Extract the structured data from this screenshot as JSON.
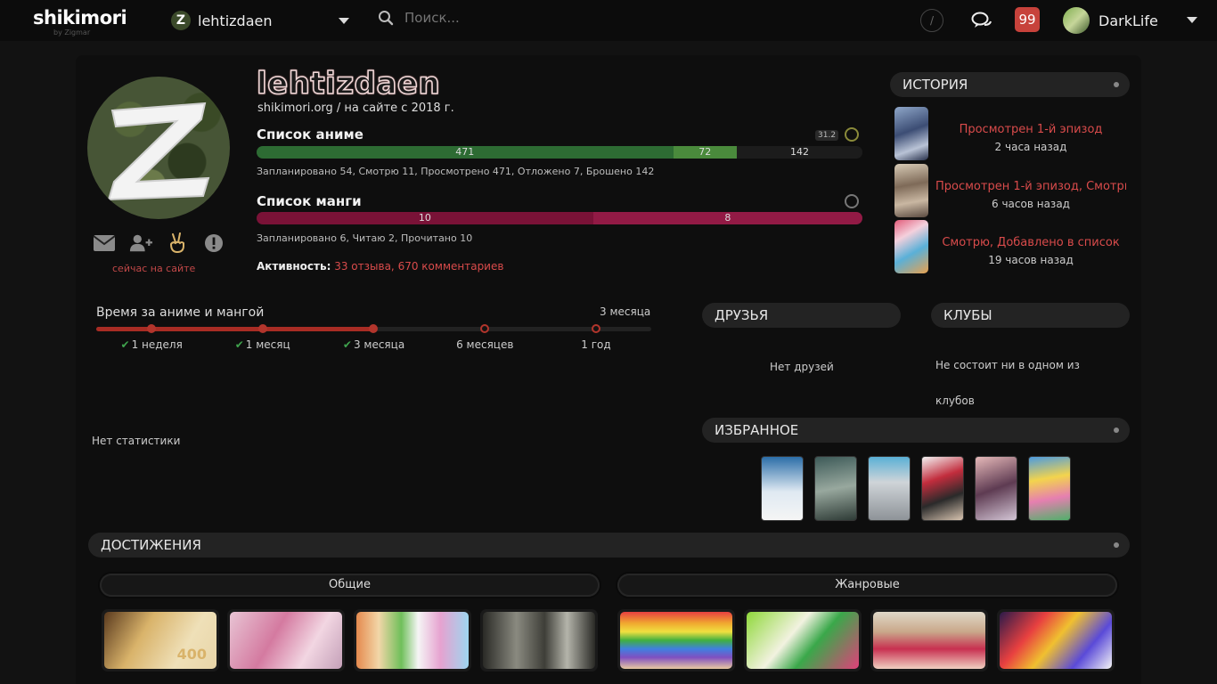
{
  "header": {
    "logo": "shikimori",
    "logo_sub": "by Zigmar",
    "selected_user": "lehtizdaen",
    "search_placeholder": "Поиск...",
    "shortcut_hint": "/",
    "notifications_count": "99",
    "current_user": "DarkLife"
  },
  "profile": {
    "username": "lehtizdaen",
    "subline": "shikimori.org / на сайте с 2018 г.",
    "online_status": "сейчас на сайте",
    "action_icons": [
      "envelope-icon",
      "add-friend-icon",
      "peace-hand-icon",
      "report-icon"
    ]
  },
  "anime_list": {
    "title": "Список аниме",
    "badge": "31.2",
    "segments": [
      {
        "label": "471",
        "value": 471,
        "color": "#2d6b33"
      },
      {
        "label": "72",
        "value": 72,
        "color": "#4a8a3c"
      },
      {
        "label": "142",
        "value": 142,
        "color": "#1c1c1c"
      }
    ],
    "stats": "Запланировано 54,  Смотрю 11,  Просмотрено 471,  Отложено 7,  Брошено 142"
  },
  "manga_list": {
    "title": "Список манги",
    "segments": [
      {
        "label": "10",
        "value": 10,
        "color": "#7a1237"
      },
      {
        "label": "8",
        "value": 8,
        "color": "#921a45"
      }
    ],
    "stats": "Запланировано 6,  Читаю 2,  Прочитано 10"
  },
  "activity": {
    "label": "Активность:",
    "reviews": "33 отзыва",
    "separator": ",",
    "comments": "670 комментариев"
  },
  "history": {
    "title": "ИСТОРИЯ",
    "items": [
      {
        "action": "Просмотрен 1-й эпизод",
        "time": "2 часа назад"
      },
      {
        "action": "Просмотрен 1-й эпизод, Смотрю",
        "time": "6 часов назад"
      },
      {
        "action": "Смотрю, Добавлено в список",
        "time": "19 часов назад"
      }
    ]
  },
  "timeline": {
    "title": "Время за аниме и мангой",
    "current": "3 месяца",
    "progress_fraction": 0.5,
    "marks": [
      {
        "label": "1 неделя",
        "done": true
      },
      {
        "label": "1 месяц",
        "done": true
      },
      {
        "label": "3 месяца",
        "done": true
      },
      {
        "label": "6 месяцев",
        "done": false
      },
      {
        "label": "1 год",
        "done": false
      }
    ],
    "check_glyph": "✔",
    "no_stats": "Нет статистики"
  },
  "friends": {
    "title": "ДРУЗЬЯ",
    "empty": "Нет друзей"
  },
  "clubs": {
    "title": "КЛУБЫ",
    "empty": "Не состоит ни в одном из клубов"
  },
  "favourites": {
    "title": "ИЗБРАННОЕ",
    "count": 6
  },
  "achievements": {
    "title": "ДОСТИЖЕНИЯ",
    "general_label": "Общие",
    "genre_label": "Жанровые",
    "general_badge": "400"
  }
}
